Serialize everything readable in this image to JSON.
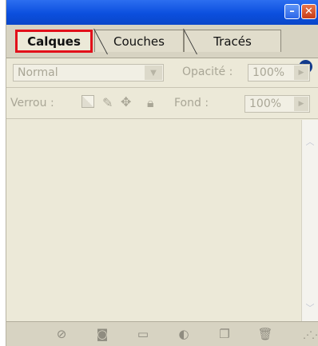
{
  "tabs": [
    {
      "label": "Calques",
      "active": true
    },
    {
      "label": "Couches",
      "active": false
    },
    {
      "label": "Tracés",
      "active": false
    }
  ],
  "blend_mode": {
    "value": "Normal"
  },
  "opacity": {
    "label": "Opacité :",
    "value": "100%"
  },
  "lock": {
    "label": "Verrou :"
  },
  "fill": {
    "label": "Fond :",
    "value": "100%"
  },
  "icons": {
    "minimize": "minimize-icon",
    "close": "close-icon",
    "panel_menu": "panel-menu-arrow-icon",
    "lock_transparent": "lock-transparent-pixels-icon",
    "lock_image": "lock-image-pixels-icon",
    "lock_position": "lock-position-icon",
    "lock_all": "lock-all-icon",
    "bottom": [
      "layer-style-icon",
      "add-mask-icon",
      "new-group-icon",
      "new-fill-adjustment-icon",
      "new-layer-icon",
      "trash-icon"
    ]
  },
  "colors": {
    "titlebar": "#0b4fde",
    "active_tab_highlight": "#e2101a",
    "panel_bg": "#ece9d8"
  }
}
